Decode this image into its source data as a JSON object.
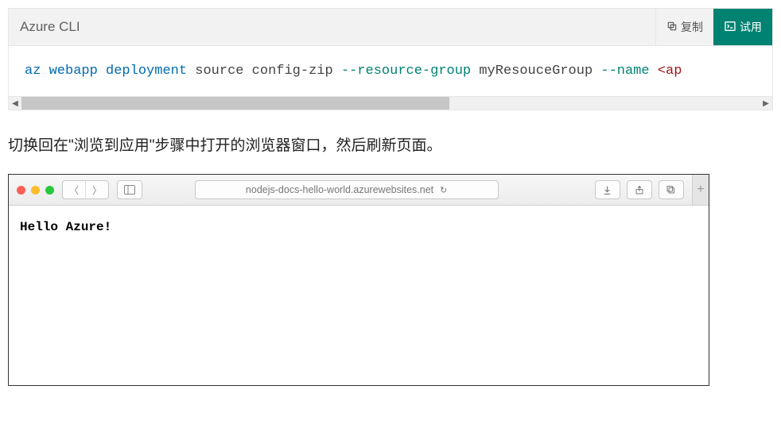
{
  "code_block": {
    "language_label": "Azure CLI",
    "copy_label": "复制",
    "try_label": "试用",
    "tokens": [
      {
        "text": "az",
        "cls": "tok-keyword"
      },
      {
        "text": " "
      },
      {
        "text": "webapp",
        "cls": "tok-keyword"
      },
      {
        "text": " "
      },
      {
        "text": "deployment",
        "cls": "tok-keyword"
      },
      {
        "text": " source config-zip "
      },
      {
        "text": "--resource-group",
        "cls": "tok-option"
      },
      {
        "text": " myResouceGroup "
      },
      {
        "text": "--name",
        "cls": "tok-option"
      },
      {
        "text": " "
      },
      {
        "text": "<ap",
        "cls": "tok-angle"
      }
    ]
  },
  "body_text": "切换回在\"浏览到应用\"步骤中打开的浏览器窗口，然后刷新页面。",
  "browser": {
    "url": "nodejs-docs-hello-world.azurewebsites.net",
    "page_content": "Hello Azure!"
  }
}
